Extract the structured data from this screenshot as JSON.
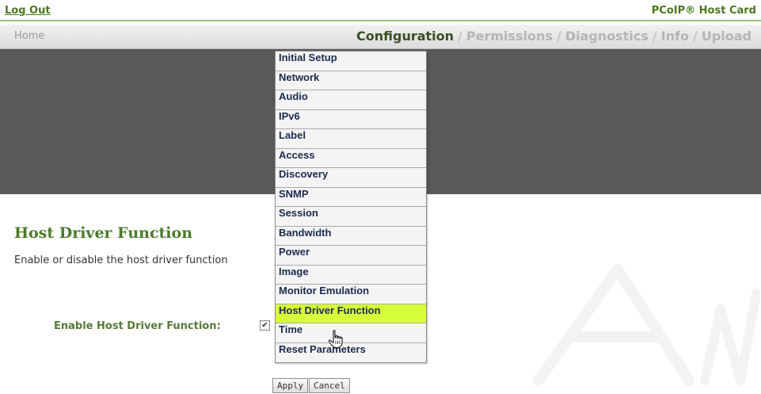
{
  "topbar": {
    "logout_label": "Log Out",
    "product_name": "PCoIP® Host Card"
  },
  "nav": {
    "home_label": "Home",
    "tabs": [
      {
        "label": "Configuration",
        "active": true
      },
      {
        "label": "Permissions",
        "active": false
      },
      {
        "label": "Diagnostics",
        "active": false
      },
      {
        "label": "Info",
        "active": false
      },
      {
        "label": "Upload",
        "active": false
      }
    ],
    "separator": "/"
  },
  "menu": {
    "items": [
      {
        "label": "Initial Setup"
      },
      {
        "label": "Network"
      },
      {
        "label": "Audio"
      },
      {
        "label": "IPv6"
      },
      {
        "label": "Label"
      },
      {
        "label": "Access"
      },
      {
        "label": "Discovery"
      },
      {
        "label": "SNMP"
      },
      {
        "label": "Session"
      },
      {
        "label": "Bandwidth"
      },
      {
        "label": "Power"
      },
      {
        "label": "Image"
      },
      {
        "label": "Monitor Emulation"
      },
      {
        "label": "Host Driver Function",
        "highlighted": true
      },
      {
        "label": "Time"
      },
      {
        "label": "Reset Parameters"
      }
    ],
    "highlight_color": "#d6ff3a"
  },
  "main": {
    "title": "Host Driver Function",
    "description": "Enable or disable the host driver function",
    "field_label": "Enable Host Driver Function:",
    "checkbox_checked": true,
    "checkmark": "✔",
    "apply_label": "Apply",
    "cancel_label": "Cancel"
  },
  "colors": {
    "accent_green": "#4b7720",
    "banner_gray": "#595959",
    "active_tab": "#3b4f22"
  },
  "icons": {
    "cursor": "hand-pointer-icon"
  }
}
